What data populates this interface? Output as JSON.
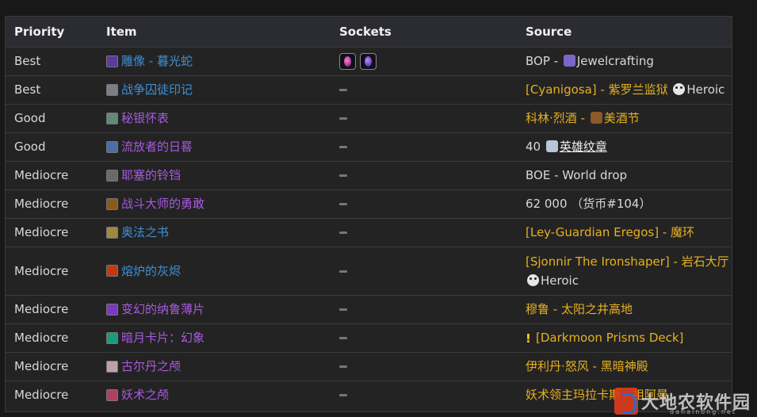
{
  "headers": {
    "priority": "Priority",
    "item": "Item",
    "sockets": "Sockets",
    "source": "Source"
  },
  "rows": [
    {
      "priority": "Best",
      "item": "雕像 - 暮光蛇",
      "item_color": "blue",
      "icon": "violet-statue-icon",
      "icon_color": "#5a3aa0",
      "sockets": [
        "pink-gem-socket",
        "purple-gem-socket"
      ],
      "source": [
        {
          "t": "BOP - ",
          "c": "plain"
        },
        {
          "mini": "jewelcrafting-icon",
          "color": "#7a66c8"
        },
        {
          "t": "Jewelcrafting",
          "c": "plain"
        }
      ]
    },
    {
      "priority": "Best",
      "item": "战争囚徒印记",
      "item_color": "blue",
      "icon": "grey-seal-icon",
      "icon_color": "#7a7f86",
      "sockets": [],
      "source": [
        {
          "t": "[Cyanigosa] - 紫罗兰监狱 ",
          "c": "gold"
        },
        {
          "skull": true
        },
        {
          "t": "Heroic",
          "c": "plain"
        }
      ]
    },
    {
      "priority": "Good",
      "item": "秘银怀表",
      "item_color": "epic",
      "icon": "pocket-watch-icon",
      "icon_color": "#5f8a7a",
      "sockets": [],
      "source": [
        {
          "t": "科林·烈酒 - ",
          "c": "gold"
        },
        {
          "mini": "brewfest-icon",
          "color": "#8a5a2a"
        },
        {
          "t": "美酒节",
          "c": "gold"
        }
      ]
    },
    {
      "priority": "Good",
      "item": "流放者的日晷",
      "item_color": "epic",
      "icon": "sundial-icon",
      "icon_color": "#4a6ea8",
      "sockets": [],
      "source": [
        {
          "t": "40 ",
          "c": "plain"
        },
        {
          "mini": "badge-of-heroism-icon",
          "color": "#b8c4d8"
        },
        {
          "t": "英雄纹章",
          "c": "underline"
        }
      ]
    },
    {
      "priority": "Mediocre",
      "item": "耶塞的铃铛",
      "item_color": "epic",
      "icon": "bell-icon",
      "icon_color": "#6a6a6a",
      "sockets": [],
      "source": [
        {
          "t": "BOE - World drop",
          "c": "plain"
        }
      ]
    },
    {
      "priority": "Mediocre",
      "item": "战斗大师的勇敢",
      "item_color": "epic",
      "icon": "battlemaster-icon",
      "icon_color": "#8a5a1a",
      "sockets": [],
      "source": [
        {
          "t": "62 000 （货币#104）",
          "c": "plain"
        }
      ]
    },
    {
      "priority": "Mediocre",
      "item": "奥法之书",
      "item_color": "blue",
      "icon": "arcane-book-icon",
      "icon_color": "#a08840",
      "sockets": [],
      "source": [
        {
          "t": "[Ley-Guardian Eregos] - 魔环",
          "c": "gold"
        }
      ]
    },
    {
      "priority": "Mediocre",
      "item": "熔炉的灰烬",
      "item_color": "blue",
      "icon": "embers-icon",
      "icon_color": "#c03a10",
      "sockets": [],
      "tall": true,
      "source": [
        {
          "t": "[Sjonnir The Ironshaper] - 岩石大厅 ",
          "c": "gold"
        },
        {
          "skull": true
        },
        {
          "t": "Heroic",
          "c": "plain"
        }
      ]
    },
    {
      "priority": "Mediocre",
      "item": "变幻的纳鲁薄片",
      "item_color": "epic",
      "icon": "naaru-sliver-icon",
      "icon_color": "#7a3ac0",
      "sockets": [],
      "source": [
        {
          "t": "穆鲁 - 太阳之井高地",
          "c": "gold"
        }
      ]
    },
    {
      "priority": "Mediocre",
      "item": "暗月卡片：幻象",
      "item_color": "epic",
      "icon": "darkmoon-card-icon",
      "icon_color": "#1a9a7a",
      "sockets": [],
      "source": [
        {
          "excl": true
        },
        {
          "t": "[Darkmoon Prisms Deck]",
          "c": "gold"
        }
      ]
    },
    {
      "priority": "Mediocre",
      "item": "古尔丹之颅",
      "item_color": "epic",
      "icon": "guldan-skull-icon",
      "icon_color": "#c0a0a8",
      "sockets": [],
      "source": [
        {
          "t": "伊利丹·怒风 - 黑暗神殿",
          "c": "gold"
        }
      ]
    },
    {
      "priority": "Mediocre",
      "item": "妖术之颅",
      "item_color": "epic",
      "icon": "hex-skull-icon",
      "icon_color": "#b04060",
      "sockets": [],
      "source": [
        {
          "t": "妖术领主玛拉卡斯 - 祖阿曼",
          "c": "gold"
        }
      ]
    }
  ],
  "watermark": {
    "text": "大地农软件园",
    "sub": "danainong.net"
  }
}
